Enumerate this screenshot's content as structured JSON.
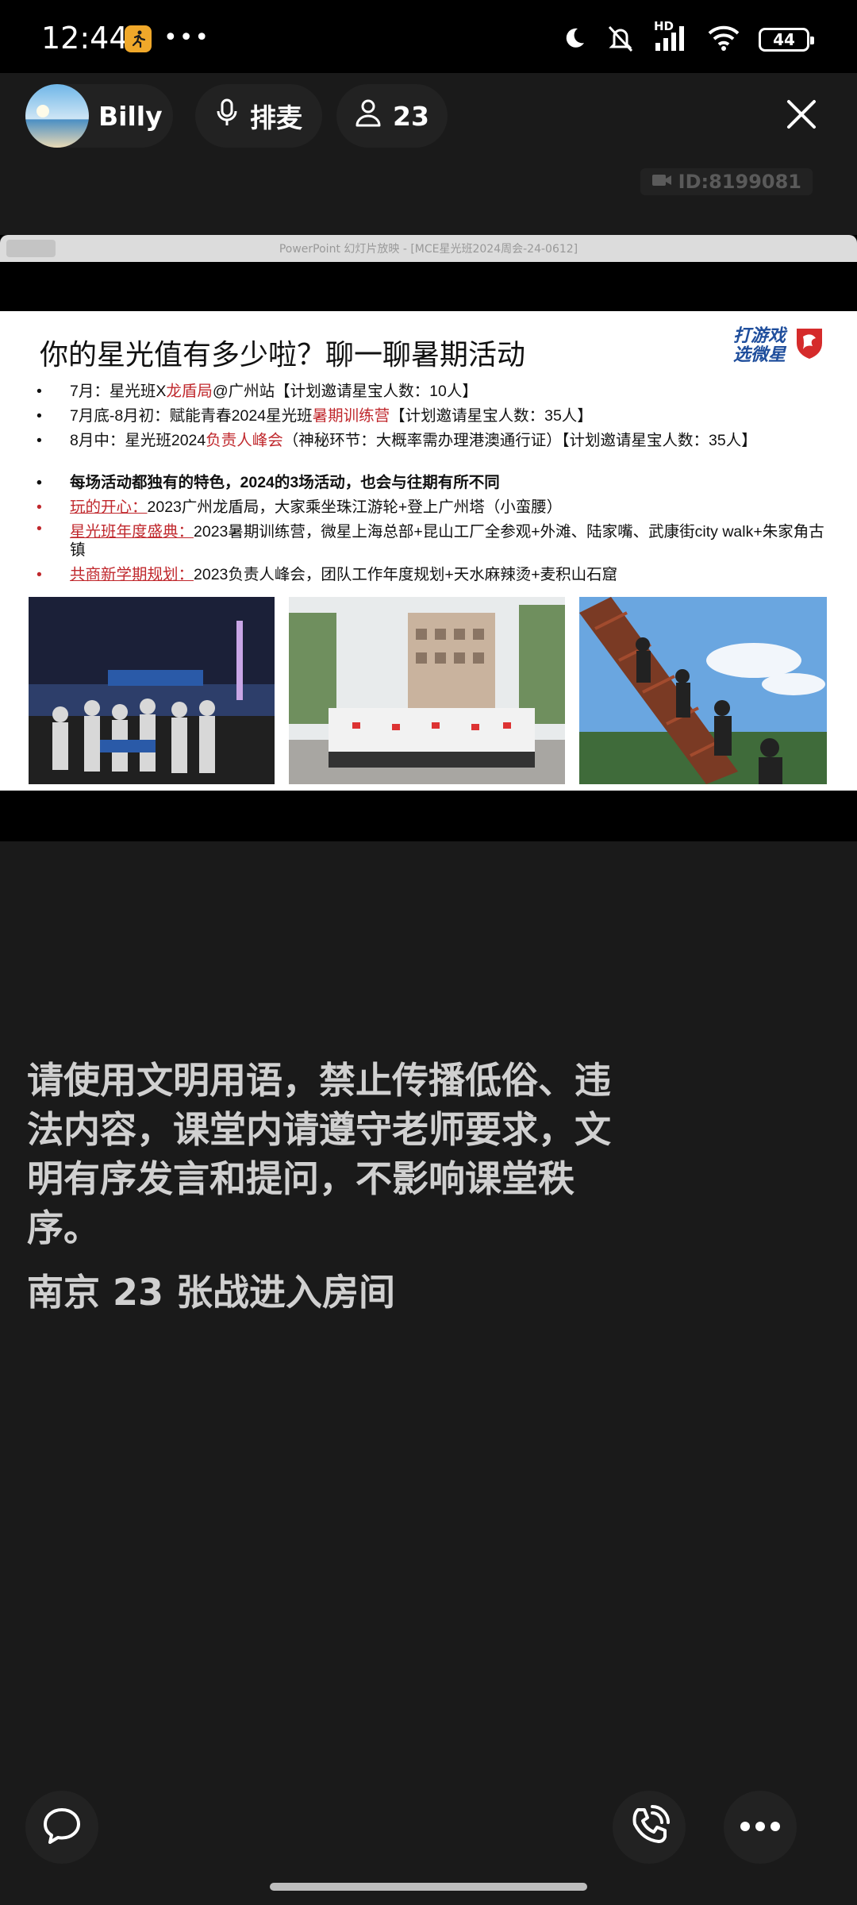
{
  "status_bar": {
    "time": "12:44",
    "more": "•••",
    "network_label": "HD",
    "battery": "44",
    "icons": [
      "running-app-icon",
      "moon-icon",
      "mute-icon",
      "signal-icon",
      "wifi-icon",
      "battery-icon"
    ]
  },
  "header": {
    "user_name": "Billy",
    "queue_label": "排麦",
    "audience_count": "23",
    "icons": [
      "microphone-icon",
      "person-icon",
      "close-icon"
    ]
  },
  "room": {
    "id_label": "ID:8199081"
  },
  "shared_window": {
    "title": "PowerPoint 幻灯片放映 - [MCE星光班2024周会-24-0612]"
  },
  "slide": {
    "title": "你的星光值有多少啦？聊一聊暑期活动",
    "logo_line1": "打游戏",
    "logo_line2": "选微星",
    "bullets": {
      "b1_a": "7月：星光班X",
      "b1_red": "龙盾局",
      "b1_b": "@广州站【计划邀请星宝人数：10人】",
      "b2_a": "7月底-8月初：赋能青春2024星光班",
      "b2_red": "暑期训练营",
      "b2_b": "【计划邀请星宝人数：35人】",
      "b3_a": "8月中：星光班2024",
      "b3_red": "负责人峰会",
      "b3_b": "（神秘环节：大概率需办理港澳通行证）【计划邀请星宝人数：35人】",
      "b4": "每场活动都独有的特色，2024的3场活动，也会与往期有所不同",
      "b5_red": "玩的开心：",
      "b5_b": "2023广州龙盾局，大家乘坐珠江游轮+登上广州塔（小蛮腰）",
      "b6_red": "星光班年度盛典：",
      "b6_b": "2023暑期训练营，微星上海总部+昆山工厂全参观+外滩、陆家嘴、武康街city walk+朱家角古镇",
      "b7_red": "共商新学期规划：",
      "b7_b": "2023负责人峰会，团队工作年度规划+天水麻辣烫+麦积山石窟"
    },
    "photos": [
      "night-river-group-photo",
      "campus-group-photo",
      "mountain-stairs-group-photo"
    ]
  },
  "chat": {
    "rules_message": "请使用文明用语，禁止传播低俗、违法内容，课堂内请遵守老师要求，文明有序发言和提问，不影响课堂秩序。",
    "join_message": "南京 23 张战进入房间"
  },
  "bottom_bar": {
    "icons": [
      "chat-bubble-icon",
      "phone-call-icon",
      "more-icon"
    ]
  }
}
